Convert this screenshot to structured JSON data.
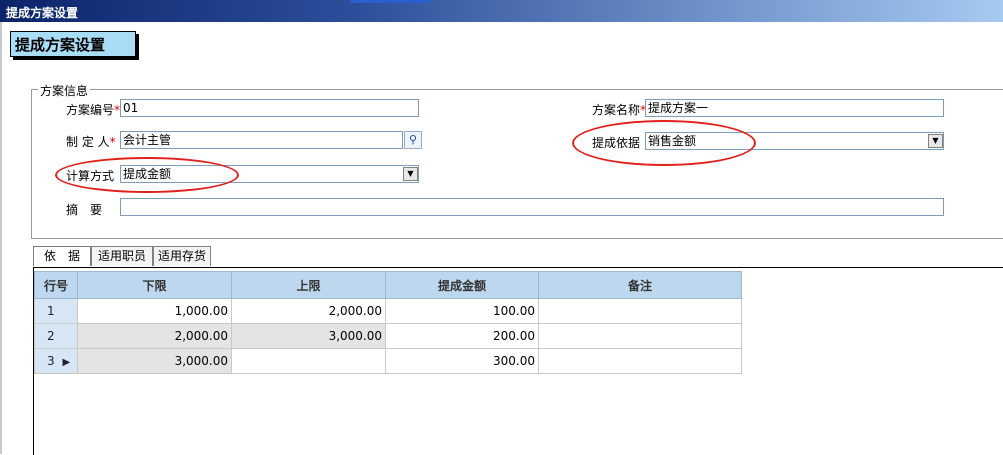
{
  "window": {
    "title": "提成方案设置"
  },
  "header": {
    "button_label": "提成方案设置"
  },
  "group": {
    "legend": "方案信息"
  },
  "form": {
    "code_label": "方案编号",
    "code_value": "01",
    "name_label": "方案名称",
    "name_value": "提成方案一",
    "creator_label": "制 定 人",
    "creator_value": "会计主管",
    "basis_label": "提成依据",
    "basis_value": "销售金额",
    "method_label": "计算方式",
    "method_value": "提成金额",
    "summary_label": "摘　要",
    "summary_value": "",
    "required_mark": "*"
  },
  "tabs": [
    {
      "label": "依　据"
    },
    {
      "label": "适用职员"
    },
    {
      "label": "适用存货"
    }
  ],
  "grid": {
    "headers": [
      "行号",
      "下限",
      "上限",
      "提成金额",
      "备注"
    ],
    "rows": [
      [
        "1",
        "1,000.00",
        "2,000.00",
        "100.00",
        ""
      ],
      [
        "2",
        "2,000.00",
        "3,000.00",
        "200.00",
        ""
      ],
      [
        "3",
        "3,000.00",
        "",
        "300.00",
        ""
      ]
    ],
    "current_row_marker": "▶"
  },
  "colors": {
    "annotation": "#e0201a",
    "grid_header": "#bcd7ee",
    "button": "#a9dcf5"
  },
  "icons": {
    "lookup": "search-icon",
    "dropdown": "chevron-down-icon"
  }
}
